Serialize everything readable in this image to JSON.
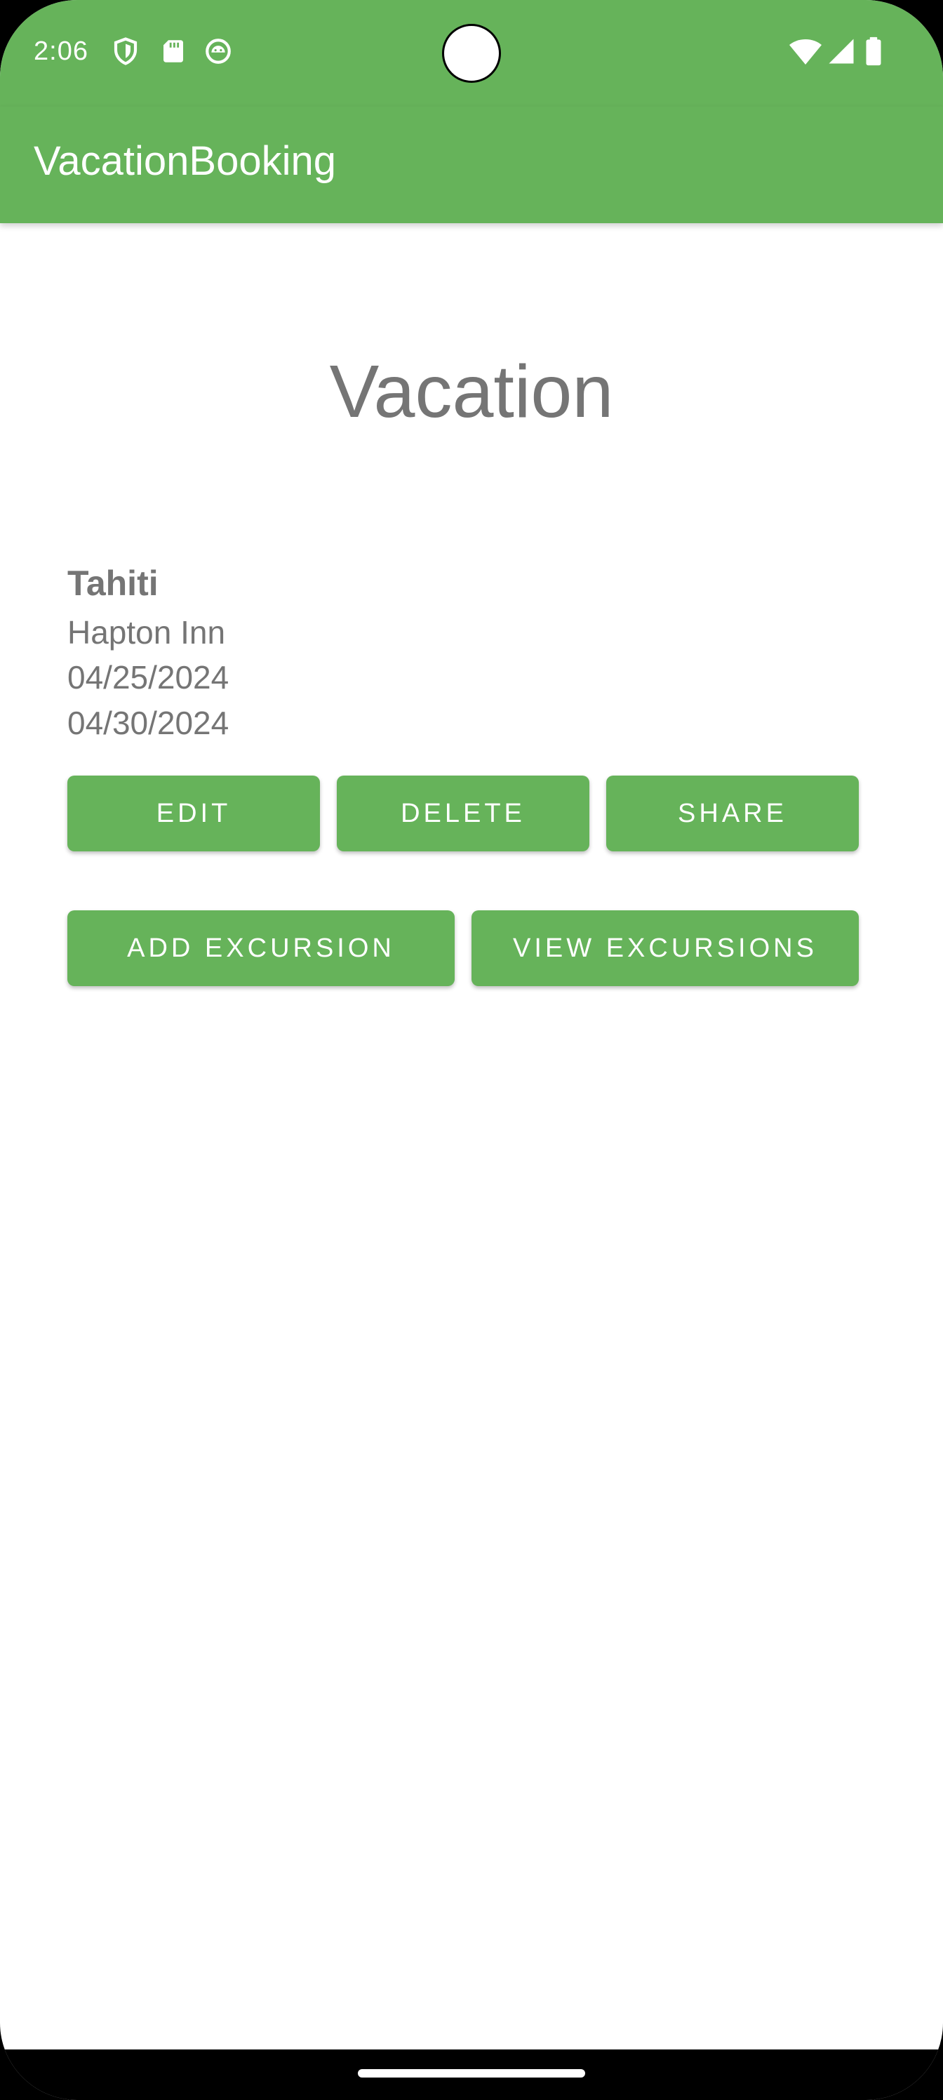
{
  "status_bar": {
    "time": "2:06",
    "icons": [
      "shield-icon",
      "sd-card-icon",
      "android-face-icon",
      "wifi-icon",
      "signal-icon",
      "battery-icon"
    ]
  },
  "app_bar": {
    "title": "VacationBooking",
    "color": "#66b35a"
  },
  "page": {
    "title": "Vacation"
  },
  "vacation": {
    "name": "Tahiti",
    "hotel": "Hapton Inn",
    "start_date": "04/25/2024",
    "end_date": "04/30/2024"
  },
  "actions": {
    "edit": "EDIT",
    "delete": "DELETE",
    "share": "SHARE",
    "add_excursion": "ADD EXCURSION",
    "view_excursions": "VIEW EXCURSIONS"
  },
  "colors": {
    "accent": "#66b35a",
    "text_secondary": "#757575"
  }
}
